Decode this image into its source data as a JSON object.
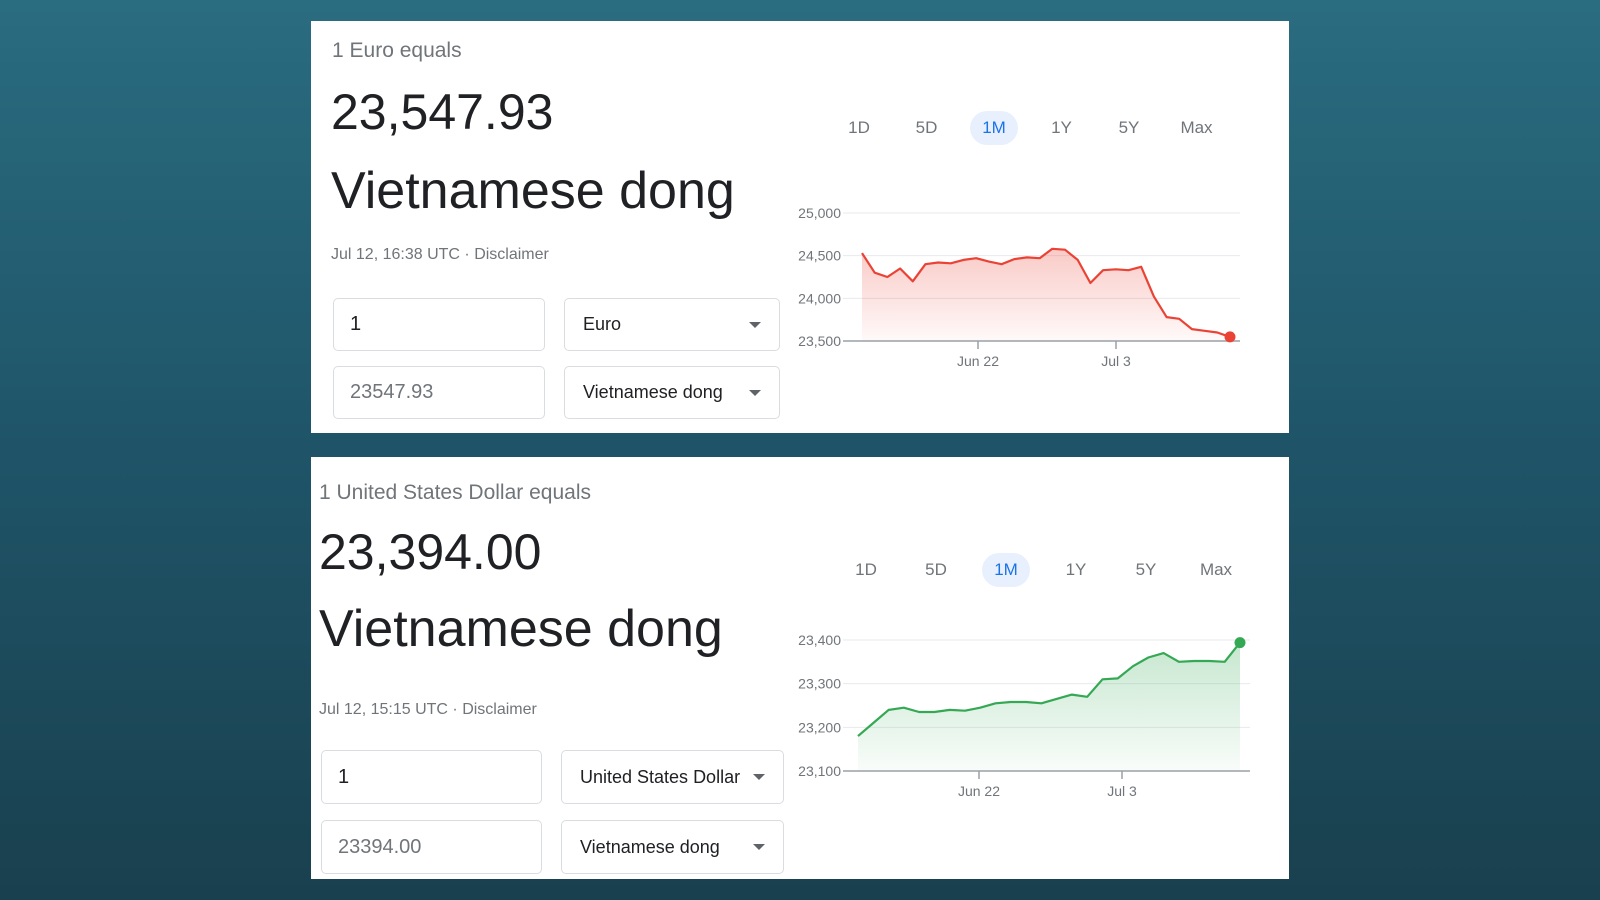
{
  "cards": [
    {
      "equals_label": "1 Euro equals",
      "rate": "23,547.93",
      "target_currency": "Vietnamese dong",
      "timestamp": "Jul 12, 16:38 UTC",
      "separator": "·",
      "disclaimer": "Disclaimer",
      "source_amount": "1",
      "source_currency": "Euro",
      "target_amount": "23547.93",
      "target_currency_select": "Vietnamese dong",
      "range_tabs": [
        "1D",
        "5D",
        "1M",
        "1Y",
        "5Y",
        "Max"
      ],
      "active_range": "1M",
      "colors": {
        "line": "#ea4335",
        "fill": "#fce8e6",
        "active_tab": "#1a73e8"
      },
      "chart_data": {
        "type": "area",
        "x_labels": [
          "Jun 22",
          "Jul 3"
        ],
        "y_ticks": [
          "25,000",
          "24,500",
          "24,000",
          "23,500"
        ],
        "ylim": [
          23500,
          25000
        ],
        "values": [
          24530,
          24300,
          24250,
          24350,
          24200,
          24400,
          24420,
          24410,
          24450,
          24470,
          24430,
          24400,
          24460,
          24480,
          24470,
          24580,
          24570,
          24450,
          24180,
          24330,
          24340,
          24330,
          24370,
          24020,
          23780,
          23760,
          23640,
          23620,
          23600,
          23548
        ],
        "line_color": "#ea4335",
        "grid": true
      }
    },
    {
      "equals_label": "1 United States Dollar equals",
      "rate": "23,394.00",
      "target_currency": "Vietnamese dong",
      "timestamp": "Jul 12, 15:15 UTC",
      "separator": "·",
      "disclaimer": "Disclaimer",
      "source_amount": "1",
      "source_currency": "United States Dollar",
      "target_amount": "23394.00",
      "target_currency_select": "Vietnamese dong",
      "range_tabs": [
        "1D",
        "5D",
        "1M",
        "1Y",
        "5Y",
        "Max"
      ],
      "active_range": "1M",
      "colors": {
        "line": "#34a853",
        "fill": "#e6f4ea",
        "active_tab": "#1a73e8"
      },
      "chart_data": {
        "type": "area",
        "x_labels": [
          "Jun 22",
          "Jul 3"
        ],
        "y_ticks": [
          "23,400",
          "23,300",
          "23,200",
          "23,100"
        ],
        "ylim": [
          23100,
          23400
        ],
        "values": [
          23180,
          23210,
          23240,
          23245,
          23235,
          23235,
          23240,
          23238,
          23245,
          23255,
          23258,
          23258,
          23255,
          23265,
          23275,
          23270,
          23310,
          23312,
          23340,
          23360,
          23370,
          23350,
          23352,
          23352,
          23350,
          23394
        ],
        "line_color": "#34a853",
        "grid": true
      }
    }
  ]
}
